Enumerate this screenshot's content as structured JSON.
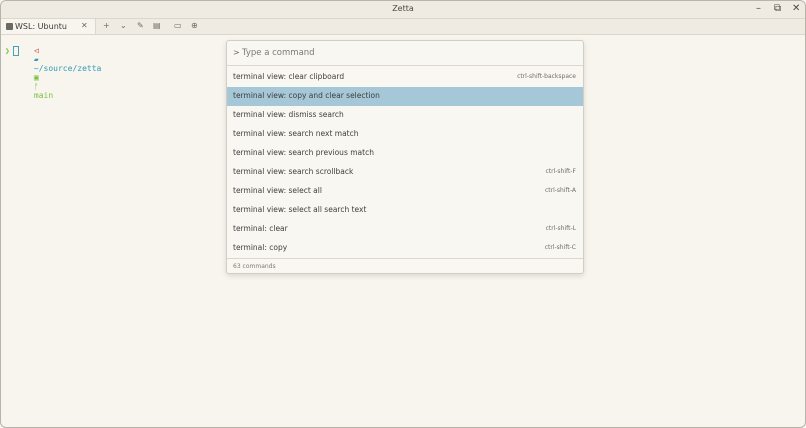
{
  "window": {
    "title": "Zetta"
  },
  "tabs": [
    {
      "label": "WSL: Ubuntu"
    }
  ],
  "terminal": {
    "cwd": "~/source/zetta",
    "branch": "main",
    "prompt_char": "❯"
  },
  "palette": {
    "prompt": ">",
    "placeholder": "Type a command",
    "items": [
      {
        "label": "terminal view: clear clipboard",
        "shortcut": "ctrl-shift-backspace"
      },
      {
        "label": "terminal view: copy and clear selection",
        "shortcut": ""
      },
      {
        "label": "terminal view: dismiss search",
        "shortcut": ""
      },
      {
        "label": "terminal view: search next match",
        "shortcut": ""
      },
      {
        "label": "terminal view: search previous match",
        "shortcut": ""
      },
      {
        "label": "terminal view: search scrollback",
        "shortcut": "ctrl-shift-F"
      },
      {
        "label": "terminal view: select all",
        "shortcut": "ctrl-shift-A"
      },
      {
        "label": "terminal view: select all search text",
        "shortcut": ""
      },
      {
        "label": "terminal: clear",
        "shortcut": "ctrl-shift-L"
      },
      {
        "label": "terminal: copy",
        "shortcut": "ctrl-shift-C"
      }
    ],
    "footer": "63 commands"
  },
  "colors": {
    "selection": "#a5c7d8",
    "path_color": "#2f9bb5",
    "branch_color": "#7bbf3f"
  }
}
